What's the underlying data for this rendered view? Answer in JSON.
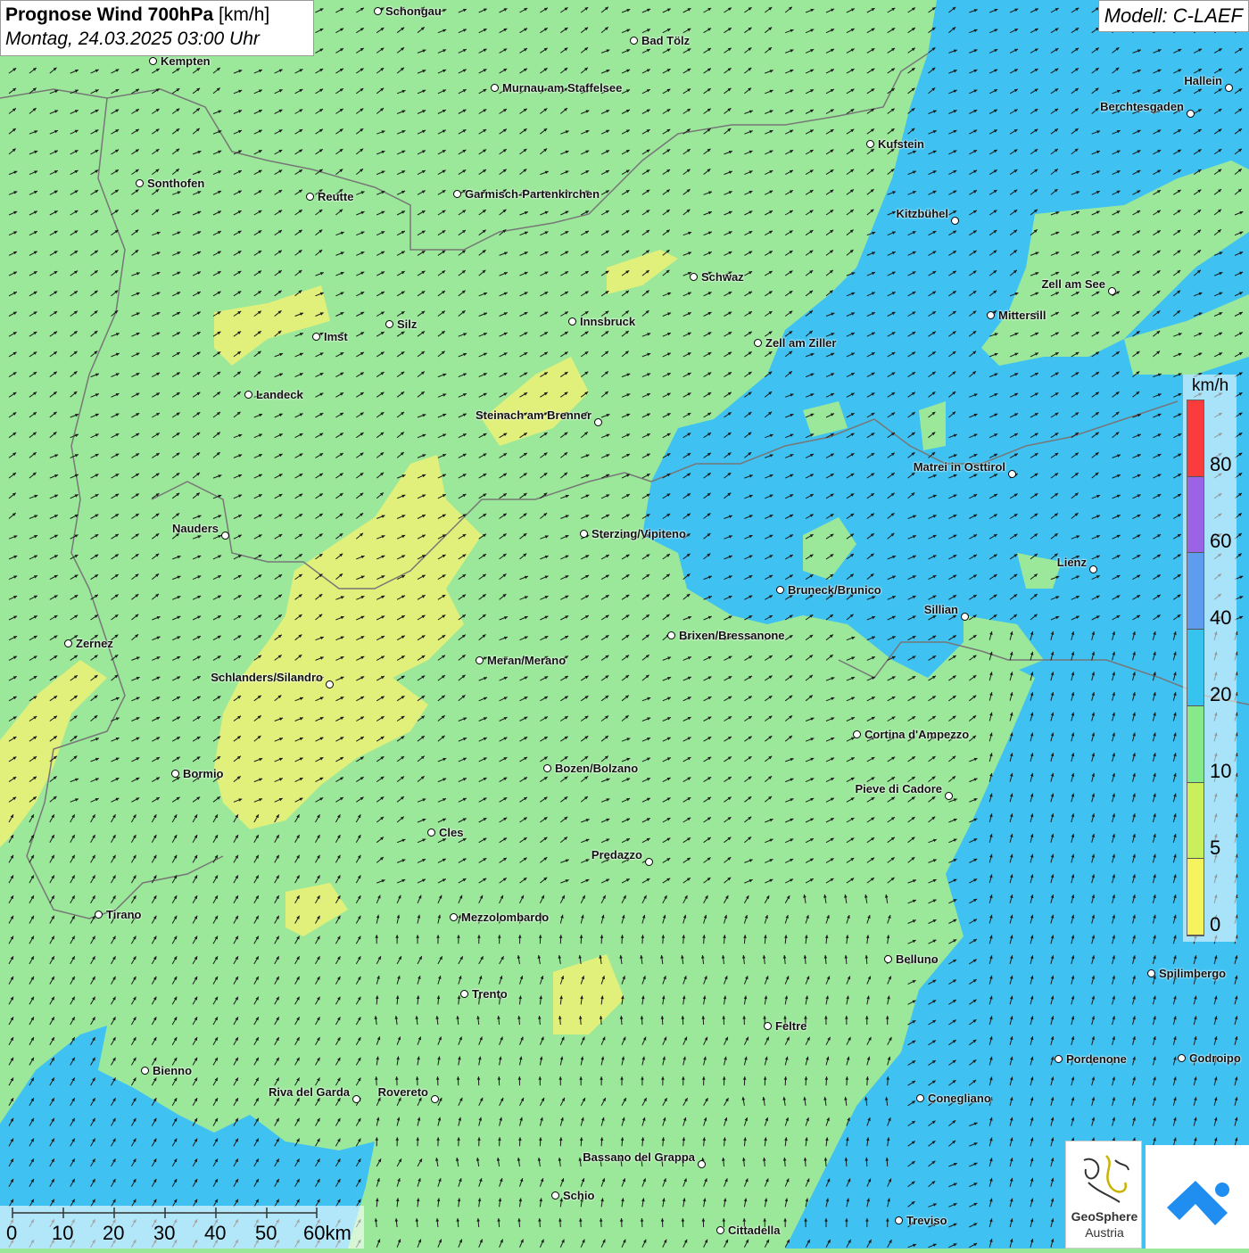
{
  "header": {
    "title_bold": "Prognose Wind 700hPa",
    "title_unit": "[km/h]",
    "datetime": "Montag, 24.03.2025 03:00 Uhr",
    "model": "Modell: C-LAEF"
  },
  "colors": {
    "land_green": "#9be89a",
    "wind_blue": "#3fc2f2",
    "wind_yellow": "#e8f27a",
    "arrow": "#1a1a1a"
  },
  "legend": {
    "unit": "km/h",
    "labels": [
      "80",
      "60",
      "40",
      "20",
      "10",
      "5",
      "0"
    ],
    "segments": [
      {
        "color": "#fa3c3c"
      },
      {
        "color": "#9b63e6"
      },
      {
        "color": "#5e9cf0"
      },
      {
        "color": "#36c4ef"
      },
      {
        "color": "#86e98a"
      },
      {
        "color": "#c9ef5a"
      },
      {
        "color": "#f6f45e"
      }
    ]
  },
  "scale_bar": {
    "labels": [
      "0",
      "10",
      "20",
      "30",
      "40",
      "50",
      "60km"
    ]
  },
  "cities": [
    {
      "name": "Schongau"
    },
    {
      "name": "Bad Tölz"
    },
    {
      "name": "Kempten"
    },
    {
      "name": "Murnau am Staffelsee"
    },
    {
      "name": "Hallein"
    },
    {
      "name": "Berchtesgaden"
    },
    {
      "name": "Kufstein"
    },
    {
      "name": "Sonthofen"
    },
    {
      "name": "Reutte"
    },
    {
      "name": "Garmisch-Partenkirchen"
    },
    {
      "name": "Kitzbühel"
    },
    {
      "name": "Schwaz"
    },
    {
      "name": "Zell am See"
    },
    {
      "name": "Mittersill"
    },
    {
      "name": "Innsbruck"
    },
    {
      "name": "Silz"
    },
    {
      "name": "Imst"
    },
    {
      "name": "Zell am Ziller"
    },
    {
      "name": "Landeck"
    },
    {
      "name": "Steinach am Brenner"
    },
    {
      "name": "Matrei in Osttirol"
    },
    {
      "name": "Nauders"
    },
    {
      "name": "Sterzing/Vipiteno"
    },
    {
      "name": "Lienz"
    },
    {
      "name": "Bruneck/Brunico"
    },
    {
      "name": "Sillian"
    },
    {
      "name": "Brixen/Bressanone"
    },
    {
      "name": "Zernez"
    },
    {
      "name": "Meran/Merano"
    },
    {
      "name": "Schlanders/Silandro"
    },
    {
      "name": "Cortina d'Ampezzo"
    },
    {
      "name": "Bozen/Bolzano"
    },
    {
      "name": "Bormio"
    },
    {
      "name": "Pieve di Cadore"
    },
    {
      "name": "Cles"
    },
    {
      "name": "Predazzo"
    },
    {
      "name": "Tirano"
    },
    {
      "name": "Mezzolombardo"
    },
    {
      "name": "Belluno"
    },
    {
      "name": "Spilimbergo"
    },
    {
      "name": "Trento"
    },
    {
      "name": "Feltre"
    },
    {
      "name": "Pordenone"
    },
    {
      "name": "Codroipo"
    },
    {
      "name": "Bienno"
    },
    {
      "name": "Riva del Garda"
    },
    {
      "name": "Rovereto"
    },
    {
      "name": "Conegliano"
    },
    {
      "name": "Bassano del Grappa"
    },
    {
      "name": "Schio"
    },
    {
      "name": "Treviso"
    },
    {
      "name": "Cittadella"
    }
  ],
  "logo": {
    "name_line1": "GeoSphere",
    "name_line2": "Austria"
  }
}
